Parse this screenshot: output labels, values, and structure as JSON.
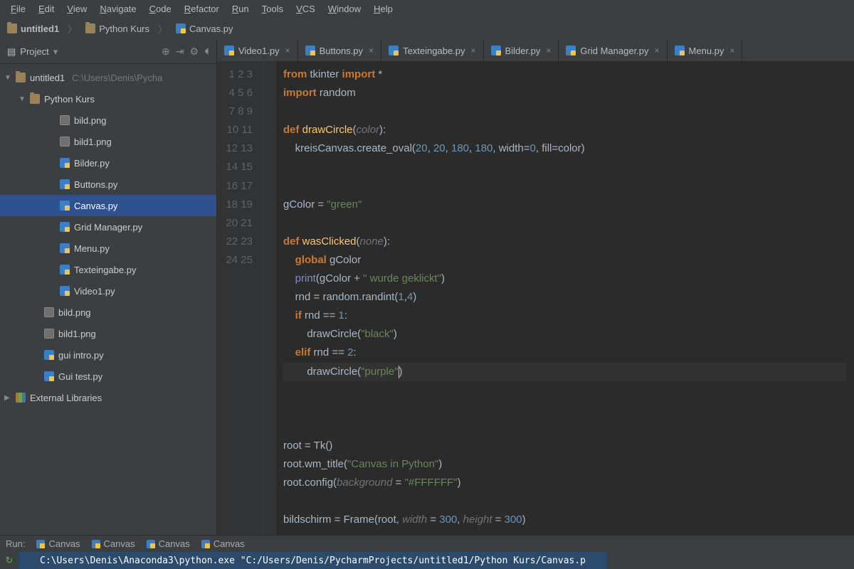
{
  "menubar": [
    "File",
    "Edit",
    "View",
    "Navigate",
    "Code",
    "Refactor",
    "Run",
    "Tools",
    "VCS",
    "Window",
    "Help"
  ],
  "breadcrumbs": [
    {
      "icon": "folder",
      "label": "untitled1"
    },
    {
      "icon": "folder",
      "label": "Python Kurs"
    },
    {
      "icon": "py",
      "label": "Canvas.py"
    }
  ],
  "sidebar": {
    "title": "Project",
    "tool_icons": [
      "target",
      "autoscroll",
      "gear",
      "collapse"
    ],
    "tree": [
      {
        "depth": "0",
        "arrow": "▼",
        "icon": "folder",
        "label": "untitled1",
        "dim": "C:\\Users\\Denis\\Pycha"
      },
      {
        "depth": "1",
        "arrow": "▼",
        "icon": "folder",
        "label": "Python Kurs"
      },
      {
        "depth": "2",
        "arrow": "",
        "icon": "img",
        "label": "bild.png"
      },
      {
        "depth": "2",
        "arrow": "",
        "icon": "img",
        "label": "bild1.png"
      },
      {
        "depth": "2",
        "arrow": "",
        "icon": "py",
        "label": "Bilder.py"
      },
      {
        "depth": "2",
        "arrow": "",
        "icon": "py",
        "label": "Buttons.py"
      },
      {
        "depth": "2",
        "arrow": "",
        "icon": "py",
        "label": "Canvas.py",
        "sel": true
      },
      {
        "depth": "2",
        "arrow": "",
        "icon": "py",
        "label": "Grid Manager.py"
      },
      {
        "depth": "2",
        "arrow": "",
        "icon": "py",
        "label": "Menu.py"
      },
      {
        "depth": "2",
        "arrow": "",
        "icon": "py",
        "label": "Texteingabe.py"
      },
      {
        "depth": "2",
        "arrow": "",
        "icon": "py",
        "label": "Video1.py"
      },
      {
        "depth": "1b",
        "arrow": "",
        "icon": "img",
        "label": "bild.png"
      },
      {
        "depth": "1b",
        "arrow": "",
        "icon": "img",
        "label": "bild1.png"
      },
      {
        "depth": "1b",
        "arrow": "",
        "icon": "py",
        "label": "gui intro.py"
      },
      {
        "depth": "1b",
        "arrow": "",
        "icon": "py",
        "label": "Gui test.py"
      },
      {
        "depth": "0",
        "arrow": "▶",
        "icon": "lib",
        "label": "External Libraries"
      }
    ]
  },
  "tabs": [
    {
      "label": "Video1.py"
    },
    {
      "label": "Buttons.py"
    },
    {
      "label": "Texteingabe.py"
    },
    {
      "label": "Bilder.py"
    },
    {
      "label": "Grid Manager.py"
    },
    {
      "label": "Menu.py"
    }
  ],
  "code_lines": 25,
  "run": {
    "label": "Run:",
    "tabs": [
      "Canvas",
      "Canvas",
      "Canvas",
      "Canvas"
    ]
  },
  "console": "C:\\Users\\Denis\\Anaconda3\\python.exe \"C:/Users/Denis/PycharmProjects/untitled1/Python Kurs/Canvas.p",
  "source": {
    "l1": "from tkinter import *",
    "l2": "import random",
    "l4": "def drawCircle(color):",
    "l5": "    kreisCanvas.create_oval(20, 20, 180, 180, width=0, fill=color)",
    "l8": "gColor = \"green\"",
    "l10": "def wasClicked(none):",
    "l11": "    global gColor",
    "l12": "    print(gColor + \" wurde geklickt\")",
    "l13": "    rnd = random.randint(1,4)",
    "l14": "    if rnd == 1:",
    "l15": "        drawCircle(\"black\")",
    "l16": "    elif rnd == 2:",
    "l17": "        drawCircle(\"purple\")",
    "l21": "root = Tk()",
    "l22": "root.wm_title(\"Canvas in Python\")",
    "l23": "root.config(background = \"#FFFFFF\")",
    "l25": "bildschirm = Frame(root, width = 300, height = 300)"
  }
}
